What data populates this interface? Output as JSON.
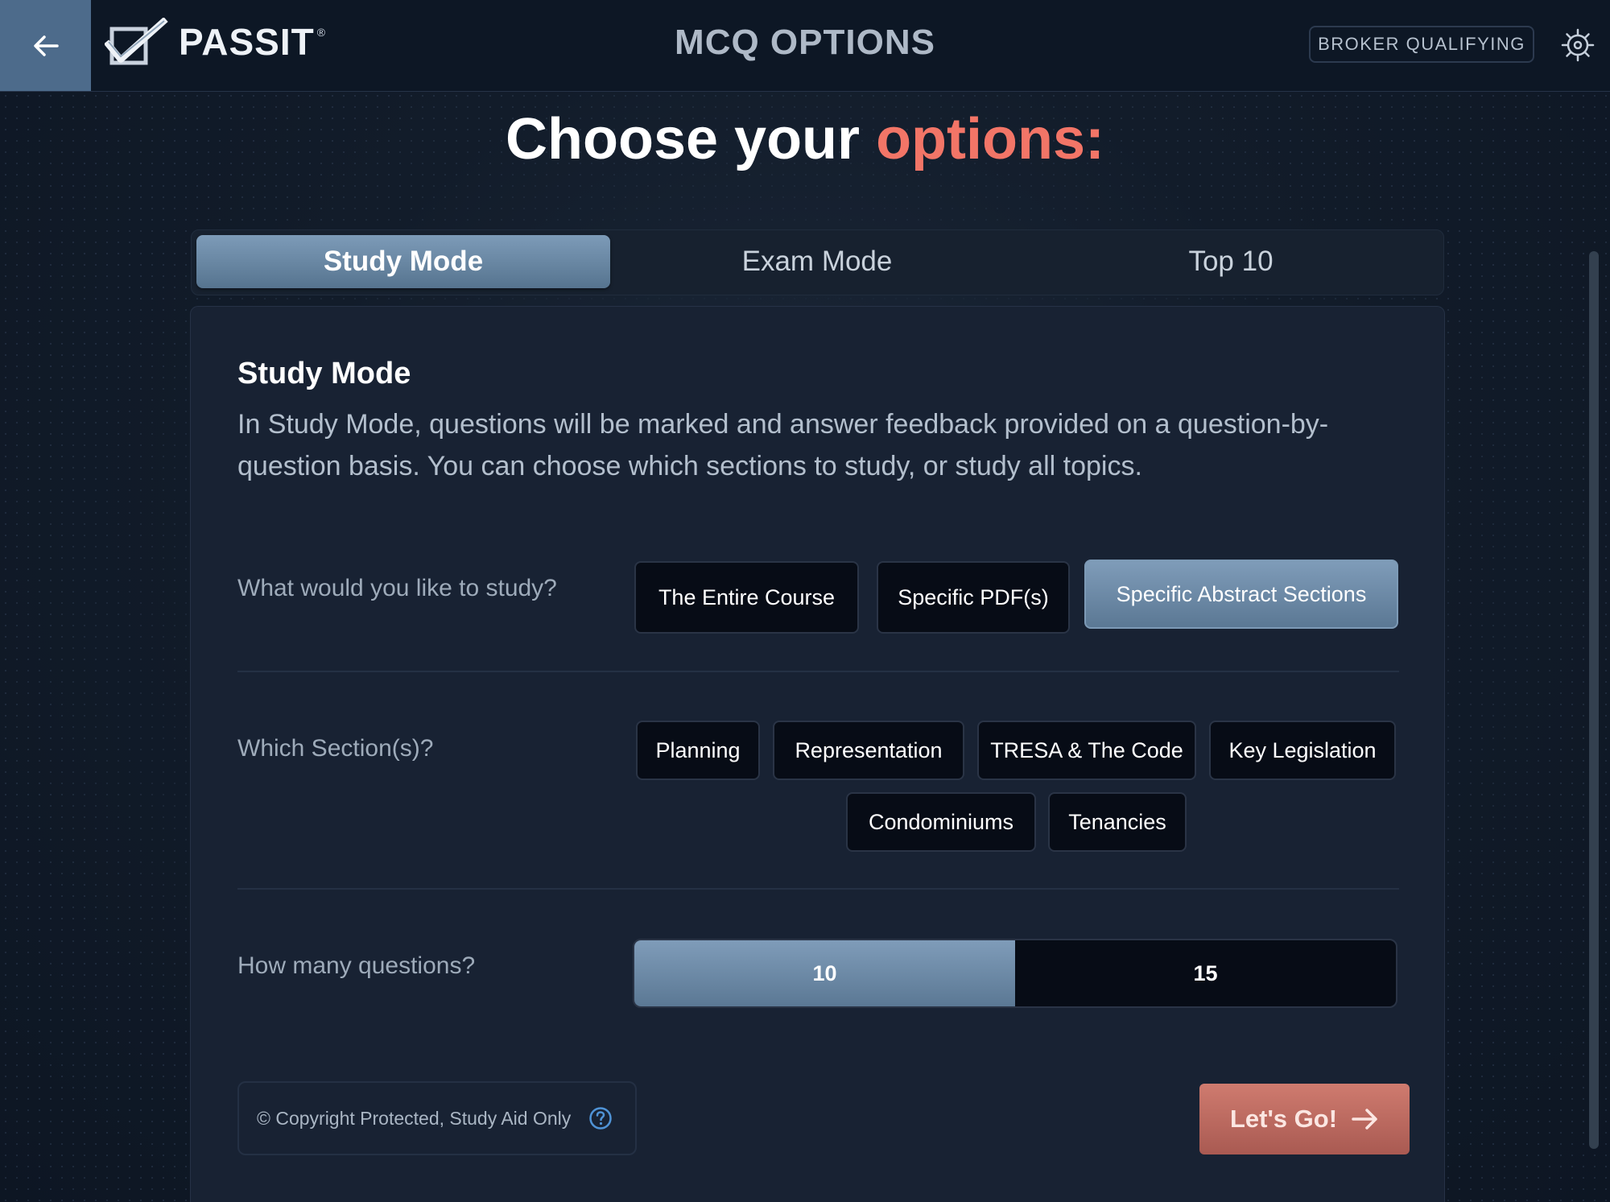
{
  "header": {
    "back_icon": "arrow-left-icon",
    "logo_text": "PASSIT",
    "logo_reg": "®",
    "app_title": "MCQ OPTIONS",
    "badge": "BROKER QUALIFYING",
    "settings_icon": "gear-icon"
  },
  "page": {
    "title_main": "Choose your",
    "title_accent": "options:",
    "accent_color": "#f27567"
  },
  "tabs": [
    {
      "label": "Study Mode",
      "active": true
    },
    {
      "label": "Exam Mode",
      "active": false
    },
    {
      "label": "Top 10",
      "active": false
    }
  ],
  "panel": {
    "title": "Study Mode",
    "description": "In Study Mode, questions will be marked and answer feedback provided on a question-by-question basis. You can choose which sections to study, or study all topics.",
    "study_question": "What would you like to study?",
    "study_options": [
      {
        "label": "The Entire Course",
        "selected": false
      },
      {
        "label": "Specific PDF(s)",
        "selected": false
      },
      {
        "label": "Specific Abstract Sections",
        "selected": true
      }
    ],
    "section_question": "Which Section(s)?",
    "sections": [
      {
        "label": "Planning"
      },
      {
        "label": "Representation"
      },
      {
        "label": "TRESA & The Code"
      },
      {
        "label": "Key Legislation"
      },
      {
        "label": "Condominiums"
      },
      {
        "label": "Tenancies"
      }
    ],
    "count_question": "How many questions?",
    "counts": [
      {
        "label": "10",
        "selected": true
      },
      {
        "label": "15",
        "selected": false
      }
    ],
    "copyright": "© Copyright Protected, Study Aid Only",
    "help_icon": "help-circle-icon",
    "go_label": "Let's Go!",
    "go_icon": "arrow-right-icon"
  }
}
